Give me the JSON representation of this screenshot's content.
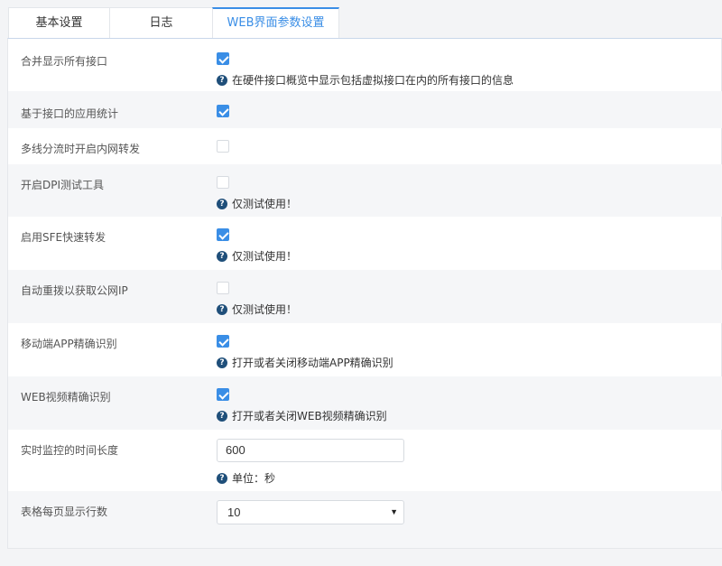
{
  "tabs": [
    {
      "label": "基本设置"
    },
    {
      "label": "日志"
    },
    {
      "label": "WEB界面参数设置",
      "active": true
    }
  ],
  "colors": {
    "accent": "#3a8ee6",
    "help_icon": "#1f4f7a"
  },
  "settings": {
    "merge_interfaces": {
      "label": "合并显示所有接口",
      "checked": true,
      "help": "在硬件接口概览中显示包括虚拟接口在内的所有接口的信息"
    },
    "app_stats": {
      "label": "基于接口的应用统计",
      "checked": true
    },
    "multiline": {
      "label": "多线分流时开启内网转发",
      "checked": false
    },
    "dpi_tool": {
      "label": "开启DPI测试工具",
      "checked": false,
      "help": "仅测试使用！"
    },
    "sfe": {
      "label": "启用SFE快速转发",
      "checked": true,
      "help": "仅测试使用！"
    },
    "redial": {
      "label": "自动重拨以获取公网IP",
      "checked": false,
      "help": "仅测试使用！"
    },
    "mobile_app": {
      "label": "移动端APP精确识别",
      "checked": true,
      "help": "打开或者关闭移动端APP精确识别"
    },
    "web_video": {
      "label": "WEB视频精确识别",
      "checked": true,
      "help": "打开或者关闭WEB视频精确识别"
    },
    "monitor_time": {
      "label": "实时监控的时间长度",
      "value": "600",
      "help": "单位：秒"
    },
    "rows_per_page": {
      "label": "表格每页显示行数",
      "selected": "10"
    }
  },
  "icons": {
    "help": "question-circle-icon",
    "dropdown": "caret-down-icon"
  }
}
